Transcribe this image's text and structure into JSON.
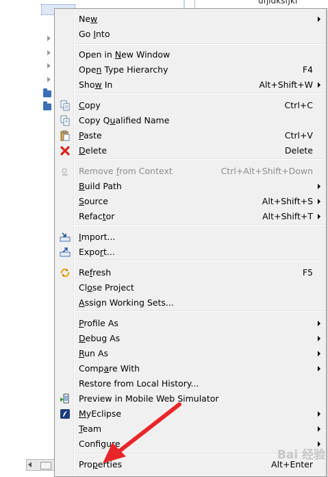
{
  "editor": {
    "text": "dfjldksfjkl"
  },
  "menu": {
    "items": [
      {
        "key": "new",
        "label": "New",
        "shortcut": "",
        "submenu": true,
        "disabled": false,
        "icon": ""
      },
      {
        "key": "go-into",
        "label": "Go Into",
        "shortcut": "",
        "submenu": false,
        "disabled": false,
        "icon": ""
      },
      {
        "key": "open-in-new-window",
        "label": "Open in New Window",
        "shortcut": "",
        "submenu": false,
        "disabled": false,
        "icon": ""
      },
      {
        "key": "open-type-hierarchy",
        "label": "Open Type Hierarchy",
        "shortcut": "F4",
        "submenu": false,
        "disabled": false,
        "icon": ""
      },
      {
        "key": "show-in",
        "label": "Show In",
        "shortcut": "Alt+Shift+W",
        "submenu": true,
        "disabled": false,
        "icon": ""
      },
      {
        "key": "copy",
        "label": "Copy",
        "shortcut": "Ctrl+C",
        "submenu": false,
        "disabled": false,
        "icon": "copy-icon"
      },
      {
        "key": "copy-qualified-name",
        "label": "Copy Qualified Name",
        "shortcut": "",
        "submenu": false,
        "disabled": false,
        "icon": "copy-qualified-name-icon"
      },
      {
        "key": "paste",
        "label": "Paste",
        "shortcut": "Ctrl+V",
        "submenu": false,
        "disabled": false,
        "icon": "paste-icon"
      },
      {
        "key": "delete",
        "label": "Delete",
        "shortcut": "Delete",
        "submenu": false,
        "disabled": false,
        "icon": "delete-icon"
      },
      {
        "key": "remove-from-context",
        "label": "Remove from Context",
        "shortcut": "Ctrl+Alt+Shift+Down",
        "submenu": false,
        "disabled": true,
        "icon": "remove-context-icon"
      },
      {
        "key": "build-path",
        "label": "Build Path",
        "shortcut": "",
        "submenu": true,
        "disabled": false,
        "icon": ""
      },
      {
        "key": "source",
        "label": "Source",
        "shortcut": "Alt+Shift+S",
        "submenu": true,
        "disabled": false,
        "icon": ""
      },
      {
        "key": "refactor",
        "label": "Refactor",
        "shortcut": "Alt+Shift+T",
        "submenu": true,
        "disabled": false,
        "icon": ""
      },
      {
        "key": "import",
        "label": "Import...",
        "shortcut": "",
        "submenu": false,
        "disabled": false,
        "icon": "import-icon"
      },
      {
        "key": "export",
        "label": "Export...",
        "shortcut": "",
        "submenu": false,
        "disabled": false,
        "icon": "export-icon"
      },
      {
        "key": "refresh",
        "label": "Refresh",
        "shortcut": "F5",
        "submenu": false,
        "disabled": false,
        "icon": "refresh-icon"
      },
      {
        "key": "close-project",
        "label": "Close Project",
        "shortcut": "",
        "submenu": false,
        "disabled": false,
        "icon": ""
      },
      {
        "key": "assign-working-sets",
        "label": "Assign Working Sets...",
        "shortcut": "",
        "submenu": false,
        "disabled": false,
        "icon": ""
      },
      {
        "key": "profile-as",
        "label": "Profile As",
        "shortcut": "",
        "submenu": true,
        "disabled": false,
        "icon": ""
      },
      {
        "key": "debug-as",
        "label": "Debug As",
        "shortcut": "",
        "submenu": true,
        "disabled": false,
        "icon": ""
      },
      {
        "key": "run-as",
        "label": "Run As",
        "shortcut": "",
        "submenu": true,
        "disabled": false,
        "icon": ""
      },
      {
        "key": "compare-with",
        "label": "Compare With",
        "shortcut": "",
        "submenu": true,
        "disabled": false,
        "icon": ""
      },
      {
        "key": "restore-from-local-history",
        "label": "Restore from Local History...",
        "shortcut": "",
        "submenu": false,
        "disabled": false,
        "icon": ""
      },
      {
        "key": "preview-mobile",
        "label": "Preview in Mobile Web Simulator",
        "shortcut": "",
        "submenu": false,
        "disabled": false,
        "icon": "mobile-simulator-icon"
      },
      {
        "key": "myeclipse",
        "label": "MyEclipse",
        "shortcut": "",
        "submenu": true,
        "disabled": false,
        "icon": "myeclipse-icon"
      },
      {
        "key": "team",
        "label": "Team",
        "shortcut": "",
        "submenu": true,
        "disabled": false,
        "icon": ""
      },
      {
        "key": "configure",
        "label": "Configure",
        "shortcut": "",
        "submenu": true,
        "disabled": false,
        "icon": ""
      },
      {
        "key": "properties",
        "label": "Properties",
        "shortcut": "Alt+Enter",
        "submenu": false,
        "disabled": false,
        "icon": ""
      }
    ]
  },
  "colors": {
    "menu_bg": "#f0f0f0",
    "disabled_text": "#8d8d8d",
    "annotation_arrow": "#e8262a",
    "delete_icon": "#d9231f",
    "folder": "#3d6fb6"
  },
  "watermark": "Bai 经验"
}
